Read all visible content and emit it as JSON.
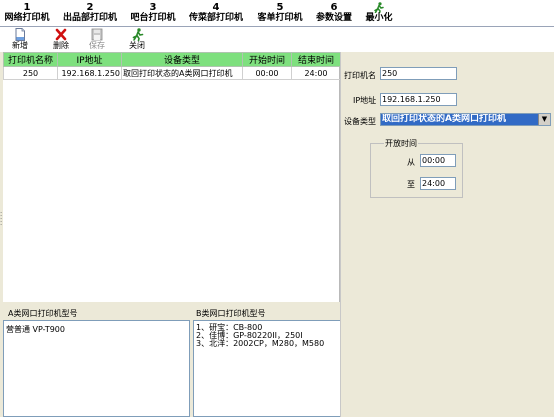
{
  "tabs": [
    {
      "num": "1",
      "label": "网络打印机"
    },
    {
      "num": "2",
      "label": "出品部打印机"
    },
    {
      "num": "3",
      "label": "吧台打印机"
    },
    {
      "num": "4",
      "label": "传菜部打印机"
    },
    {
      "num": "5",
      "label": "客单打印机"
    },
    {
      "num": "6",
      "label": "参数设置"
    },
    {
      "num": "",
      "label": "最小化"
    }
  ],
  "toolbar": {
    "add_label": "新增",
    "delete_label": "删除",
    "save_label": "保存",
    "close_label": "关闭"
  },
  "grid": {
    "headers": [
      "打印机名称",
      "IP地址",
      "设备类型",
      "开始时间",
      "结束时间"
    ],
    "rows": [
      [
        "250",
        "192.168.1.250",
        "取回打印状态的A类网口打印机",
        "00:00",
        "24:00"
      ]
    ]
  },
  "form": {
    "printer_name_label": "打印机名",
    "printer_name_value": "250",
    "ip_label": "IP地址",
    "ip_value": "192.168.1.250",
    "device_type_label": "设备类型",
    "device_type_value": "取回打印状态的A类网口打印机",
    "open_time_title": "开放时间",
    "from_label": "从",
    "from_value": "00:00",
    "to_label": "至",
    "to_value": "24:00"
  },
  "bottom": {
    "a_label": "A类网口打印机型号",
    "b_label": "B类网口打印机型号",
    "a_text": "营普通 VP-T900",
    "b_text": "1、研宝：CB-800\n2、佳博：GP-80220II，250I\n3、北洋：2002CP，M280，M580"
  },
  "colors": {
    "grid_header": "#7ee07e",
    "selection": "#316ac5"
  }
}
